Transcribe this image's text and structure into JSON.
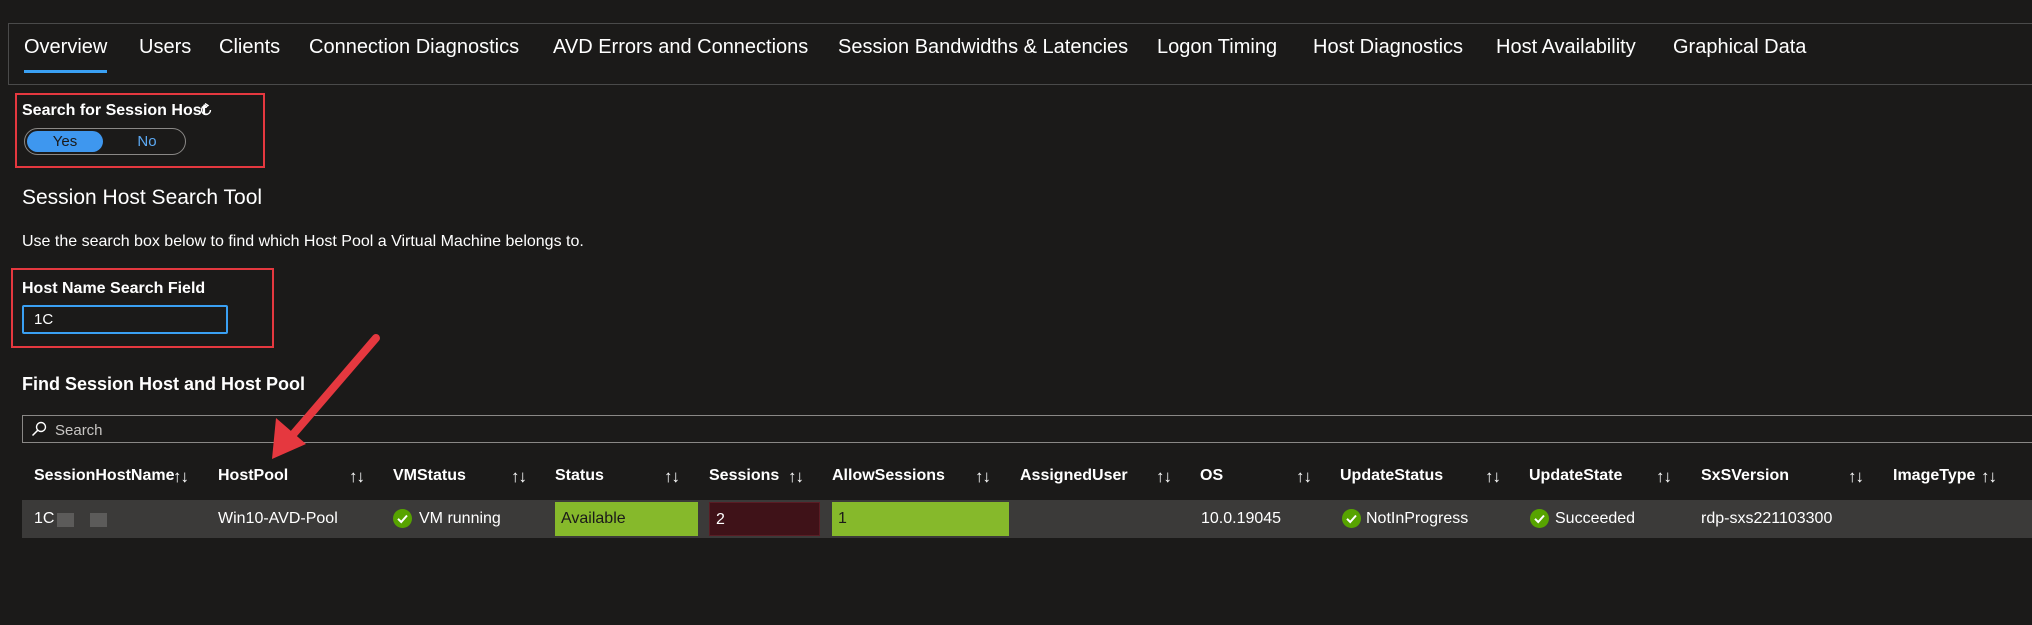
{
  "tabs": [
    {
      "label": "Overview",
      "active": true
    },
    {
      "label": "Users"
    },
    {
      "label": "Clients"
    },
    {
      "label": "Connection Diagnostics"
    },
    {
      "label": "AVD Errors and Connections"
    },
    {
      "label": "Session Bandwidths & Latencies"
    },
    {
      "label": "Logon Timing"
    },
    {
      "label": "Host Diagnostics"
    },
    {
      "label": "Host Availability"
    },
    {
      "label": "Graphical Data"
    }
  ],
  "search_session_host": {
    "label": "Search for Session Host",
    "options": [
      "Yes",
      "No"
    ],
    "selected": "Yes"
  },
  "tool": {
    "title": "Session Host Search Tool",
    "description": "Use the search box below to find which Host Pool a Virtual Machine belongs to."
  },
  "host_name_field": {
    "label": "Host Name Search Field",
    "value": "1C"
  },
  "results": {
    "title": "Find Session Host and Host Pool",
    "search_placeholder": "Search",
    "columns": [
      "SessionHostName",
      "HostPool",
      "VMStatus",
      "Status",
      "Sessions",
      "AllowSessions",
      "AssignedUser",
      "OS",
      "UpdateStatus",
      "UpdateState",
      "SxSVersion",
      "ImageType"
    ],
    "sort_glyph": "↑↓",
    "rows": [
      {
        "SessionHostName": "1C",
        "HostPool": "Win10-AVD-Pool",
        "VMStatus": "VM running",
        "Status": "Available",
        "Sessions": "2",
        "AllowSessions": "1",
        "AssignedUser": "",
        "OS": "10.0.19045",
        "UpdateStatus": "NotInProgress",
        "UpdateState": "Succeeded",
        "SxSVersion": "rdp-sxs221103300",
        "ImageType": ""
      }
    ]
  },
  "colors": {
    "background": "#1b1a19",
    "accent": "#3aa0f3",
    "highlight_box": "#e5383f",
    "available_green": "#86b92b",
    "sessions_dark_red": "#3f1218",
    "success_green": "#57a300"
  }
}
